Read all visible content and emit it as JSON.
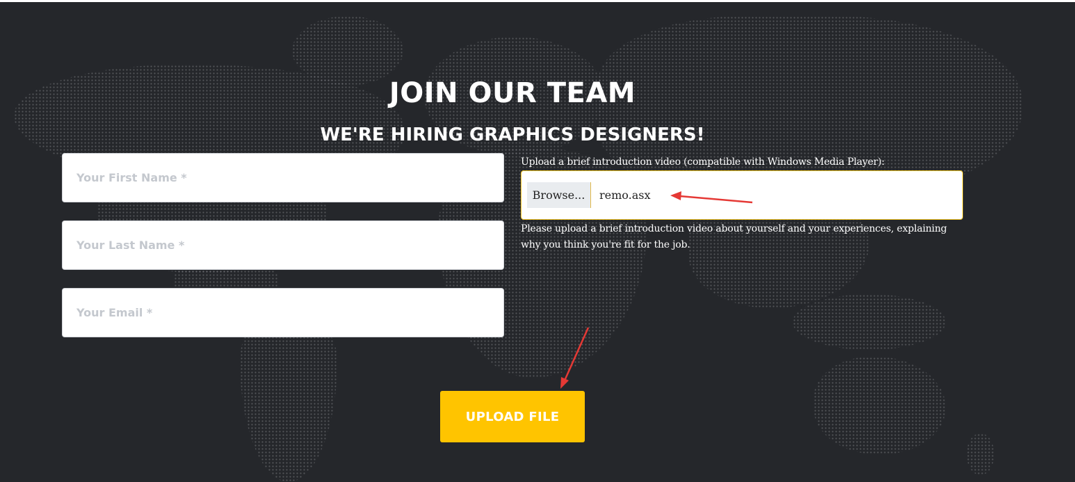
{
  "header": {
    "title": "JOIN OUR TEAM",
    "subtitle": "WE'RE HIRING GRAPHICS DESIGNERS!"
  },
  "form": {
    "first_name": {
      "placeholder": "Your First Name *",
      "value": ""
    },
    "last_name": {
      "placeholder": "Your Last Name *",
      "value": ""
    },
    "email": {
      "placeholder": "Your Email *",
      "value": ""
    },
    "upload": {
      "label": "Upload a brief introduction video (compatible with Windows Media Player):",
      "browse_label": "Browse...",
      "file_name": "remo.asx",
      "help": "Please upload a brief introduction video about yourself and your experiences, explaining why you think you're fit for the job."
    },
    "submit_label": "UPLOAD FILE"
  },
  "colors": {
    "background": "#25272b",
    "accent": "#ffc400",
    "annotation_arrow": "#e53935"
  },
  "icons": {
    "annotation_arrows": "arrow-annotation-icon"
  }
}
